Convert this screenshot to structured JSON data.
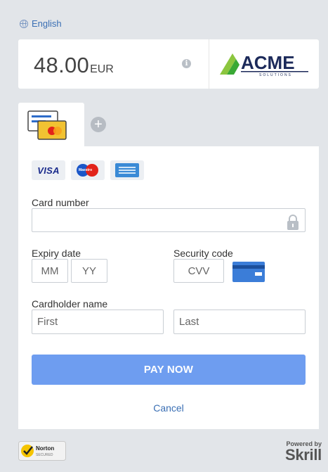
{
  "language": {
    "label": "English",
    "icon": "globe-icon"
  },
  "header": {
    "amount": "48.00",
    "currency": "EUR",
    "info_icon_glyph": "i",
    "merchant_logo_text": "ACME",
    "merchant_logo_subtext": "SOLUTIONS"
  },
  "payment_methods": {
    "active_tab_icon": "card-methods-icon",
    "add_icon_glyph": "+"
  },
  "card_brands": {
    "visa": "VISA",
    "maestro": "Maestro",
    "amex": "amex-icon"
  },
  "form": {
    "card_number_label": "Card number",
    "card_number_value": "",
    "expiry_label": "Expiry date",
    "expiry_month_placeholder": "MM",
    "expiry_year_placeholder": "YY",
    "security_label": "Security code",
    "cvv_placeholder": "CVV",
    "cardholder_label": "Cardholder name",
    "first_placeholder": "First",
    "last_placeholder": "Last"
  },
  "actions": {
    "pay_label": "PAY NOW",
    "cancel_label": "Cancel"
  },
  "footer": {
    "norton_text": "Norton",
    "norton_subtext": "SECURED",
    "powered_by": "Powered by",
    "provider": "Skrill"
  },
  "colors": {
    "background": "#e2e5e9",
    "pay_button": "#6e9df0",
    "link": "#3a6fb4",
    "logo_green": "#3aa935",
    "logo_navy": "#1c2a5a"
  }
}
